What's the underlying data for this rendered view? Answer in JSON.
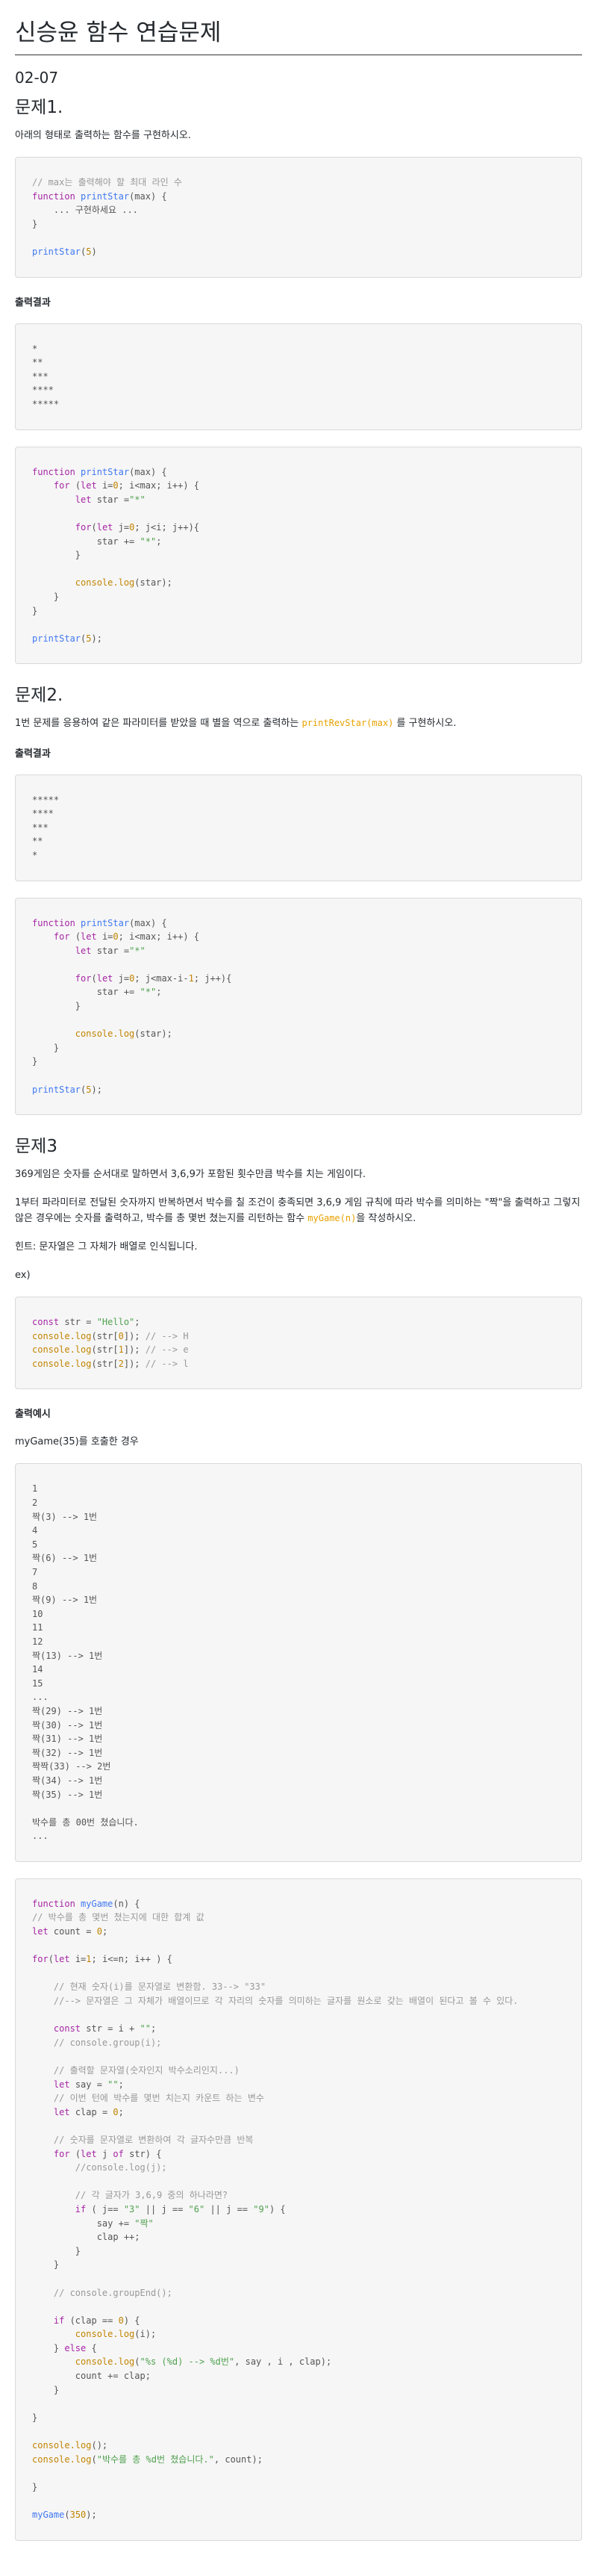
{
  "page_title": "신승윤 함수 연습문제",
  "date": "02-07",
  "p1": {
    "heading": "문제1.",
    "desc": "아래의 형태로 출력하는 함수를 구현하시오.",
    "template": [
      "// max는 출력해야 할 최대 라인 수",
      "function printStar(max) {",
      "    ... 구현하세요 ...",
      "}",
      "",
      "printStar(5)"
    ],
    "output_label": "출력결과",
    "output": [
      "*",
      "**",
      "***",
      "****",
      "*****"
    ],
    "solution": [
      "function printStar(max) {",
      "    for (let i=0; i<max; i++) {",
      "        let star =\"*\"",
      "",
      "        for(let j=0; j<i; j++){",
      "            star += \"*\";",
      "        }",
      "",
      "        console.log(star);",
      "    }",
      "}",
      "",
      "printStar(5);"
    ]
  },
  "p2": {
    "heading": "문제2.",
    "desc_before": "1번 문제를 응용하여 같은 파라미터를 받았을 때 별을 역으로 출력하는 ",
    "desc_code": "printRevStar(max)",
    "desc_after": " 를 구현하시오.",
    "output_label": "출력결과",
    "output": [
      "*****",
      "****",
      "***",
      "**",
      "*"
    ],
    "solution": [
      "function printStar(max) {",
      "    for (let i=0; i<max; i++) {",
      "        let star =\"*\"",
      "",
      "        for(let j=0; j<max-i-1; j++){",
      "            star += \"*\";",
      "        }",
      "",
      "        console.log(star);",
      "    }",
      "}",
      "",
      "printStar(5);"
    ]
  },
  "p3": {
    "heading": "문제3",
    "desc1": "369게임은 숫자를 순서대로 말하면서 3,6,9가 포함된 횟수만큼 박수를 치는 게임이다.",
    "desc2_before": "1부터 파라미터로 전달된 숫자까지 반복하면서 박수를 칠 조건이 충족되면 3,6,9 게임 규칙에 따라 박수를 의미하는 \"짝\"을 출력하고 그렇지 않은 경우에는 숫자를 출력하고, 박수를 총 몇번 쳤는지를 리턴하는 함수 ",
    "desc2_code": "myGame(n)",
    "desc2_after": "을 작성하시오.",
    "hint": "힌트: 문자열은 그 자체가 배열로 인식됩니다.",
    "ex_label": "ex)",
    "example": [
      "const str = \"Hello\";",
      "console.log(str[0]); // --> H",
      "console.log(str[1]); // --> e",
      "console.log(str[2]); // --> l"
    ],
    "output_label": "출력예시",
    "call_desc": "myGame(35)를 호출한 경우",
    "output": [
      "1",
      "2",
      "짝(3) --> 1번",
      "4",
      "5",
      "짝(6) --> 1번",
      "7",
      "8",
      "짝(9) --> 1번",
      "10",
      "11",
      "12",
      "짝(13) --> 1번",
      "14",
      "15",
      "...",
      "짝(29) --> 1번",
      "짝(30) --> 1번",
      "짝(31) --> 1번",
      "짝(32) --> 1번",
      "짝짝(33) --> 2번",
      "짝(34) --> 1번",
      "짝(35) --> 1번",
      "",
      "박수를 총 00번 쳤습니다.",
      "..."
    ],
    "solution": [
      "function myGame(n) {",
      "// 박수를 총 몇번 쳤는지에 대한 합계 값",
      "let count = 0;",
      "",
      "for(let i=1; i<=n; i++ ) {",
      "",
      "    // 현재 숫자(i)를 문자열로 변환함. 33--> \"33\"",
      "    //--> 문자열은 그 자체가 배열이므로 각 자리의 숫자를 의미하는 글자를 원소로 갖는 배열이 된다고 볼 수 있다.",
      "",
      "    const str = i + \"\";",
      "    // console.group(i);",
      "",
      "    // 출력할 문자열(숫자인지 박수소리인지...)",
      "    let say = \"\";",
      "    // 이번 턴에 박수를 몇번 치는지 카운트 하는 변수",
      "    let clap = 0;",
      "",
      "    // 숫자를 문자열로 변환하여 각 글자수만큼 반복",
      "    for (let j of str) {",
      "        //console.log(j);",
      "",
      "        // 각 글자가 3,6,9 중의 하나라면?",
      "        if ( j== \"3\" || j == \"6\" || j == \"9\") {",
      "            say += \"짝\"",
      "            clap ++;",
      "        }",
      "    }",
      "",
      "    // console.groupEnd();",
      "",
      "    if (clap == 0) {",
      "        console.log(i);",
      "    } else {",
      "        console.log(\"%s (%d) --> %d번\", say , i , clap);",
      "        count += clap;",
      "    }",
      "",
      "}",
      "",
      "console.log();",
      "console.log(\"박수를 총 %d번 쳤습니다.\", count);",
      "",
      "}",
      "",
      "myGame(350);"
    ]
  }
}
